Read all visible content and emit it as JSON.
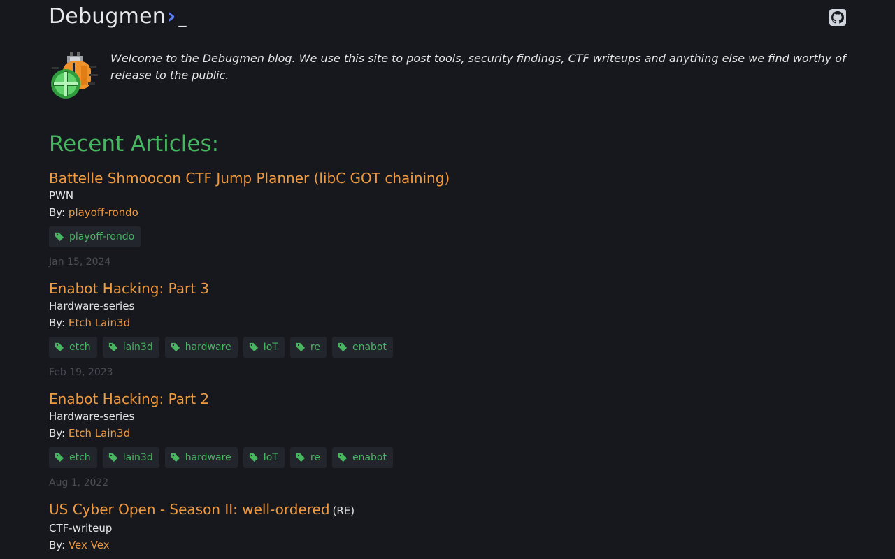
{
  "site": {
    "name": "Debugmen",
    "prompt": "›",
    "cursor": "_"
  },
  "intro": "Welcome to the Debugmen blog. We use this site to post tools, security findings, CTF writeups and anything else we find worthy of release to the public.",
  "section_title": "Recent Articles:",
  "by_label": "By:",
  "articles": [
    {
      "title": "Battelle Shmoocon CTF Jump Planner (libC GOT chaining)",
      "suffix": "",
      "category": "PWN",
      "author": "playoff-rondo",
      "tags": [
        "playoff-rondo"
      ],
      "date": "Jan 15, 2024"
    },
    {
      "title": "Enabot Hacking: Part 3",
      "suffix": "",
      "category": "Hardware-series",
      "author": "Etch Lain3d",
      "tags": [
        "etch",
        "lain3d",
        "hardware",
        "IoT",
        "re",
        "enabot"
      ],
      "date": "Feb 19, 2023"
    },
    {
      "title": "Enabot Hacking: Part 2",
      "suffix": "",
      "category": "Hardware-series",
      "author": "Etch Lain3d",
      "tags": [
        "etch",
        "lain3d",
        "hardware",
        "IoT",
        "re",
        "enabot"
      ],
      "date": "Aug 1, 2022"
    },
    {
      "title": "US Cyber Open - Season II: well-ordered",
      "suffix": "(RE)",
      "category": "CTF-writeup",
      "author": "Vex Vex",
      "tags": [],
      "date": ""
    }
  ],
  "colors": {
    "background": "#16181d",
    "accent_green": "#48b561",
    "accent_orange": "#f09a3f",
    "prompt_blue": "#5b7cf2"
  },
  "icons": {
    "github": "github-icon",
    "tag": "tag-icon",
    "logo": "bug-logo"
  }
}
